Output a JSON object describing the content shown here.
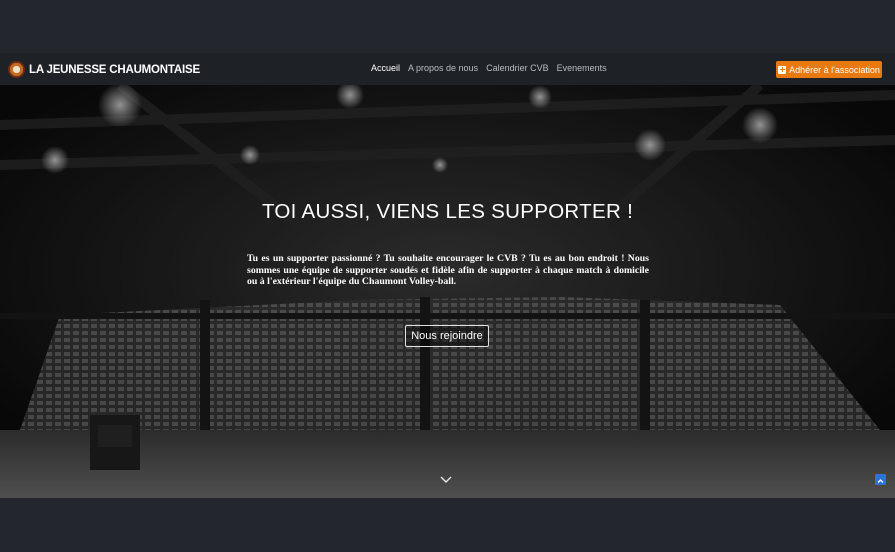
{
  "navbar": {
    "brand": "LA JEUNESSE CHAUMONTAISE",
    "links": [
      "Accueil",
      "A propos de nous",
      "Calendrier CVB",
      "Evenements"
    ],
    "active_link": "Accueil",
    "cta_label": "Adhérer à l'association",
    "cta_color": "#e8790f"
  },
  "hero": {
    "title": "TOI AUSSI, VIENS LES SUPPORTER !",
    "text": "Tu es un supporter passionné ? Tu souhaite encourager le CVB ? Tu es au bon endroit ! Nous sommes une équipe de supporter soudés et fidèle afin de supporter à chaque match à domicile ou à l'extérieur l'équipe du Chaumont Volley-ball.",
    "button_label": "Nous rejoindre"
  },
  "icons": {
    "logo": "club-logo-icon",
    "cta": "plus-square-icon",
    "scroll": "chevron-down-icon",
    "top": "arrow-up-icon"
  },
  "colors": {
    "page_background": "#23272d",
    "navbar_background": "#1e2227",
    "scroll_top_button": "#2b73d6"
  }
}
